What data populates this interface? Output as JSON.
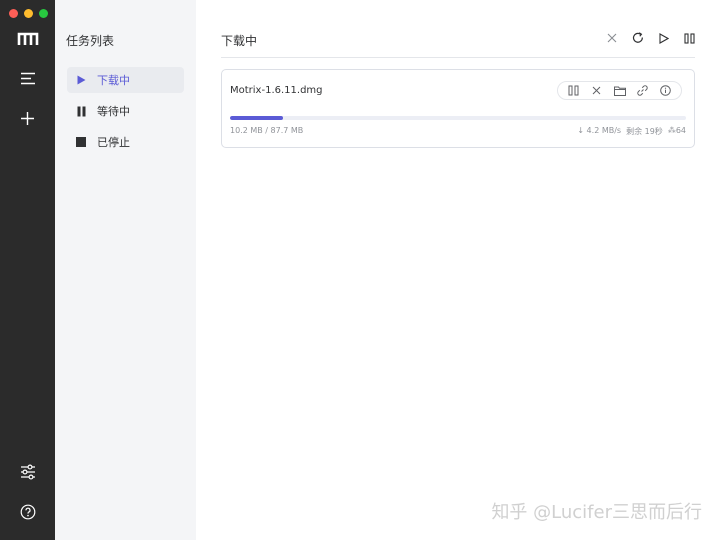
{
  "window": {
    "traffic_lights": {
      "close": "#fe5f57",
      "minimize": "#febc2e",
      "zoom": "#28c840"
    }
  },
  "rail": {
    "items": [
      {
        "name": "logo",
        "icon": "motrix-logo-icon"
      },
      {
        "name": "menu",
        "icon": "menu-icon"
      },
      {
        "name": "add",
        "icon": "plus-icon"
      },
      {
        "name": "preferences",
        "icon": "sliders-icon"
      },
      {
        "name": "help",
        "icon": "help-circle-icon"
      }
    ],
    "background": "#2b2b2b"
  },
  "sidebar": {
    "title": "任务列表",
    "items": [
      {
        "label": "下载中",
        "icon": "play-icon",
        "active": true
      },
      {
        "label": "等待中",
        "icon": "pause-icon",
        "active": false
      },
      {
        "label": "已停止",
        "icon": "stop-icon",
        "active": false
      }
    ]
  },
  "main": {
    "title": "下载中",
    "toolbar": [
      {
        "name": "clear",
        "icon": "close-icon"
      },
      {
        "name": "refresh",
        "icon": "refresh-icon"
      },
      {
        "name": "resume-all",
        "icon": "play-icon"
      },
      {
        "name": "pause-all",
        "icon": "pause-icon"
      }
    ],
    "task": {
      "filename": "Motrix-1.6.11.dmg",
      "progress": 0.117,
      "size_text": "10.2 MB / 87.7 MB",
      "speed": "↓ 4.2 MB/s",
      "remaining": "剩余 19秒",
      "connections": "⁂64",
      "actions": [
        {
          "name": "pause",
          "icon": "pause-icon"
        },
        {
          "name": "delete",
          "icon": "close-icon"
        },
        {
          "name": "show-in-folder",
          "icon": "folder-icon"
        },
        {
          "name": "copy-link",
          "icon": "link-icon"
        },
        {
          "name": "info",
          "icon": "info-icon"
        }
      ]
    }
  },
  "accent": "#5b5bd6",
  "watermark": "知乎 @Lucifer三思而后行"
}
